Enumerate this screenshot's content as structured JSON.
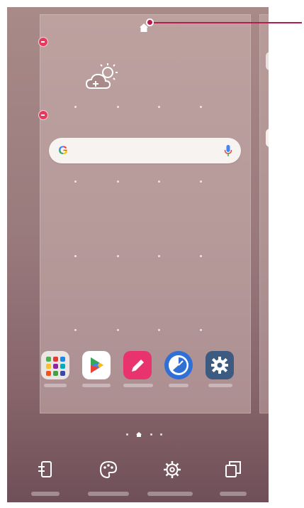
{
  "screen": "home-screen-edit-mode",
  "callout": {
    "target": "main-home-page-indicator",
    "color": "#b21f4e"
  },
  "search_widget": {
    "logo_text": "G",
    "mic_icon": "mic-icon"
  },
  "dock": {
    "apps": [
      {
        "name": "folder",
        "icon": "folder-icon"
      },
      {
        "name": "play-store",
        "icon": "play-store-icon"
      },
      {
        "name": "notes",
        "icon": "pen-icon"
      },
      {
        "name": "clock",
        "icon": "clock-icon"
      },
      {
        "name": "settings",
        "icon": "gear-icon"
      }
    ]
  },
  "page_indicators": {
    "current": 2,
    "total": 4
  },
  "bottom_bar": {
    "items": [
      {
        "name": "widgets",
        "icon": "widgets-icon"
      },
      {
        "name": "wallpapers-themes",
        "icon": "palette-icon"
      },
      {
        "name": "home-screen-settings",
        "icon": "settings-gear-icon"
      },
      {
        "name": "sort-apps",
        "icon": "copy-pages-icon"
      }
    ]
  },
  "colors": {
    "accent": "#b21f4e",
    "remove_badge": "#e63b5f",
    "play_blue": "#4285f4",
    "notes_pink": "#e8336f",
    "clock_blue": "#2f6fd6",
    "settings_blue": "#3d5a80"
  }
}
